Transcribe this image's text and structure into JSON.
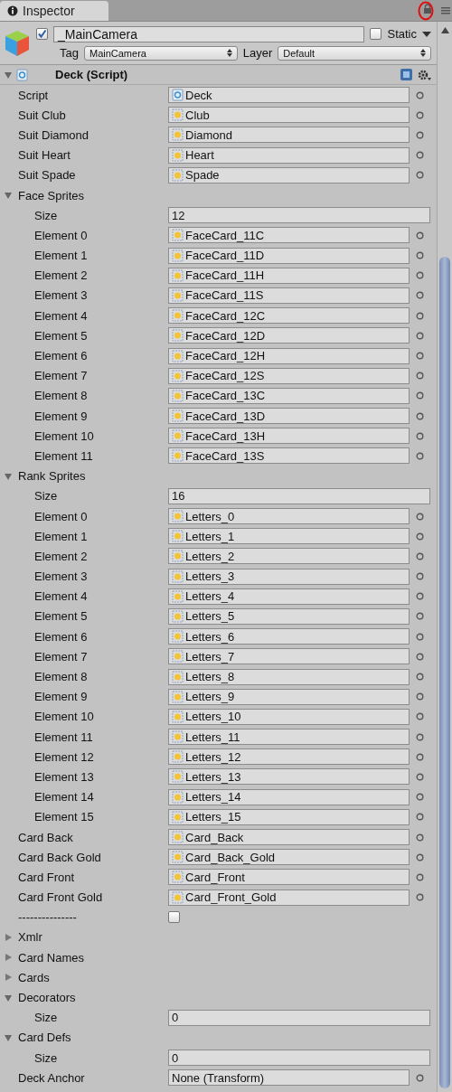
{
  "tab": {
    "label": "Inspector",
    "selected": true
  },
  "object": {
    "active": true,
    "name": "_MainCamera",
    "static": {
      "label": "Static",
      "checked": false
    },
    "tag": {
      "label": "Tag",
      "value": "MainCamera"
    },
    "layer": {
      "label": "Layer",
      "value": "Default"
    }
  },
  "component": {
    "title": "Deck (Script)",
    "expanded": true,
    "rows": [
      {
        "kind": "script-field",
        "label": "Script",
        "value": "Deck"
      },
      {
        "kind": "sprite-field",
        "label": "Suit Club",
        "value": "Club"
      },
      {
        "kind": "sprite-field",
        "label": "Suit Diamond",
        "value": "Diamond"
      },
      {
        "kind": "sprite-field",
        "label": "Suit Heart",
        "value": "Heart"
      },
      {
        "kind": "sprite-field",
        "label": "Suit Spade",
        "value": "Spade"
      },
      {
        "kind": "foldout",
        "label": "Face Sprites",
        "expanded": true,
        "children": [
          {
            "kind": "int-field",
            "label": "Size",
            "value": "12"
          },
          {
            "kind": "sprite-field",
            "label": "Element 0",
            "value": "FaceCard_11C"
          },
          {
            "kind": "sprite-field",
            "label": "Element 1",
            "value": "FaceCard_11D"
          },
          {
            "kind": "sprite-field",
            "label": "Element 2",
            "value": "FaceCard_11H"
          },
          {
            "kind": "sprite-field",
            "label": "Element 3",
            "value": "FaceCard_11S"
          },
          {
            "kind": "sprite-field",
            "label": "Element 4",
            "value": "FaceCard_12C"
          },
          {
            "kind": "sprite-field",
            "label": "Element 5",
            "value": "FaceCard_12D"
          },
          {
            "kind": "sprite-field",
            "label": "Element 6",
            "value": "FaceCard_12H"
          },
          {
            "kind": "sprite-field",
            "label": "Element 7",
            "value": "FaceCard_12S"
          },
          {
            "kind": "sprite-field",
            "label": "Element 8",
            "value": "FaceCard_13C"
          },
          {
            "kind": "sprite-field",
            "label": "Element 9",
            "value": "FaceCard_13D"
          },
          {
            "kind": "sprite-field",
            "label": "Element 10",
            "value": "FaceCard_13H"
          },
          {
            "kind": "sprite-field",
            "label": "Element 11",
            "value": "FaceCard_13S"
          }
        ]
      },
      {
        "kind": "foldout",
        "label": "Rank Sprites",
        "expanded": true,
        "children": [
          {
            "kind": "int-field",
            "label": "Size",
            "value": "16"
          },
          {
            "kind": "sprite-field",
            "label": "Element 0",
            "value": "Letters_0"
          },
          {
            "kind": "sprite-field",
            "label": "Element 1",
            "value": "Letters_1"
          },
          {
            "kind": "sprite-field",
            "label": "Element 2",
            "value": "Letters_2"
          },
          {
            "kind": "sprite-field",
            "label": "Element 3",
            "value": "Letters_3"
          },
          {
            "kind": "sprite-field",
            "label": "Element 4",
            "value": "Letters_4"
          },
          {
            "kind": "sprite-field",
            "label": "Element 5",
            "value": "Letters_5"
          },
          {
            "kind": "sprite-field",
            "label": "Element 6",
            "value": "Letters_6"
          },
          {
            "kind": "sprite-field",
            "label": "Element 7",
            "value": "Letters_7"
          },
          {
            "kind": "sprite-field",
            "label": "Element 8",
            "value": "Letters_8"
          },
          {
            "kind": "sprite-field",
            "label": "Element 9",
            "value": "Letters_9"
          },
          {
            "kind": "sprite-field",
            "label": "Element 10",
            "value": "Letters_10"
          },
          {
            "kind": "sprite-field",
            "label": "Element 11",
            "value": "Letters_11"
          },
          {
            "kind": "sprite-field",
            "label": "Element 12",
            "value": "Letters_12"
          },
          {
            "kind": "sprite-field",
            "label": "Element 13",
            "value": "Letters_13"
          },
          {
            "kind": "sprite-field",
            "label": "Element 14",
            "value": "Letters_14"
          },
          {
            "kind": "sprite-field",
            "label": "Element 15",
            "value": "Letters_15"
          }
        ]
      },
      {
        "kind": "sprite-field",
        "label": "Card Back",
        "value": "Card_Back"
      },
      {
        "kind": "sprite-field",
        "label": "Card Back Gold",
        "value": "Card_Back_Gold"
      },
      {
        "kind": "sprite-field",
        "label": "Card Front",
        "value": "Card_Front"
      },
      {
        "kind": "sprite-field",
        "label": "Card Front Gold",
        "value": "Card_Front_Gold"
      },
      {
        "kind": "toggle",
        "label": "---------------",
        "checked": false
      },
      {
        "kind": "foldout",
        "label": "Xmlr",
        "expanded": false
      },
      {
        "kind": "foldout",
        "label": "Card Names",
        "expanded": false
      },
      {
        "kind": "foldout",
        "label": "Cards",
        "expanded": false
      },
      {
        "kind": "foldout",
        "label": "Decorators",
        "expanded": true,
        "children": [
          {
            "kind": "int-field",
            "label": "Size",
            "value": "0"
          }
        ]
      },
      {
        "kind": "foldout",
        "label": "Card Defs",
        "expanded": true,
        "children": [
          {
            "kind": "int-field",
            "label": "Size",
            "value": "0"
          }
        ]
      },
      {
        "kind": "object-field",
        "label": "Deck Anchor",
        "value": "None (Transform)"
      }
    ]
  }
}
